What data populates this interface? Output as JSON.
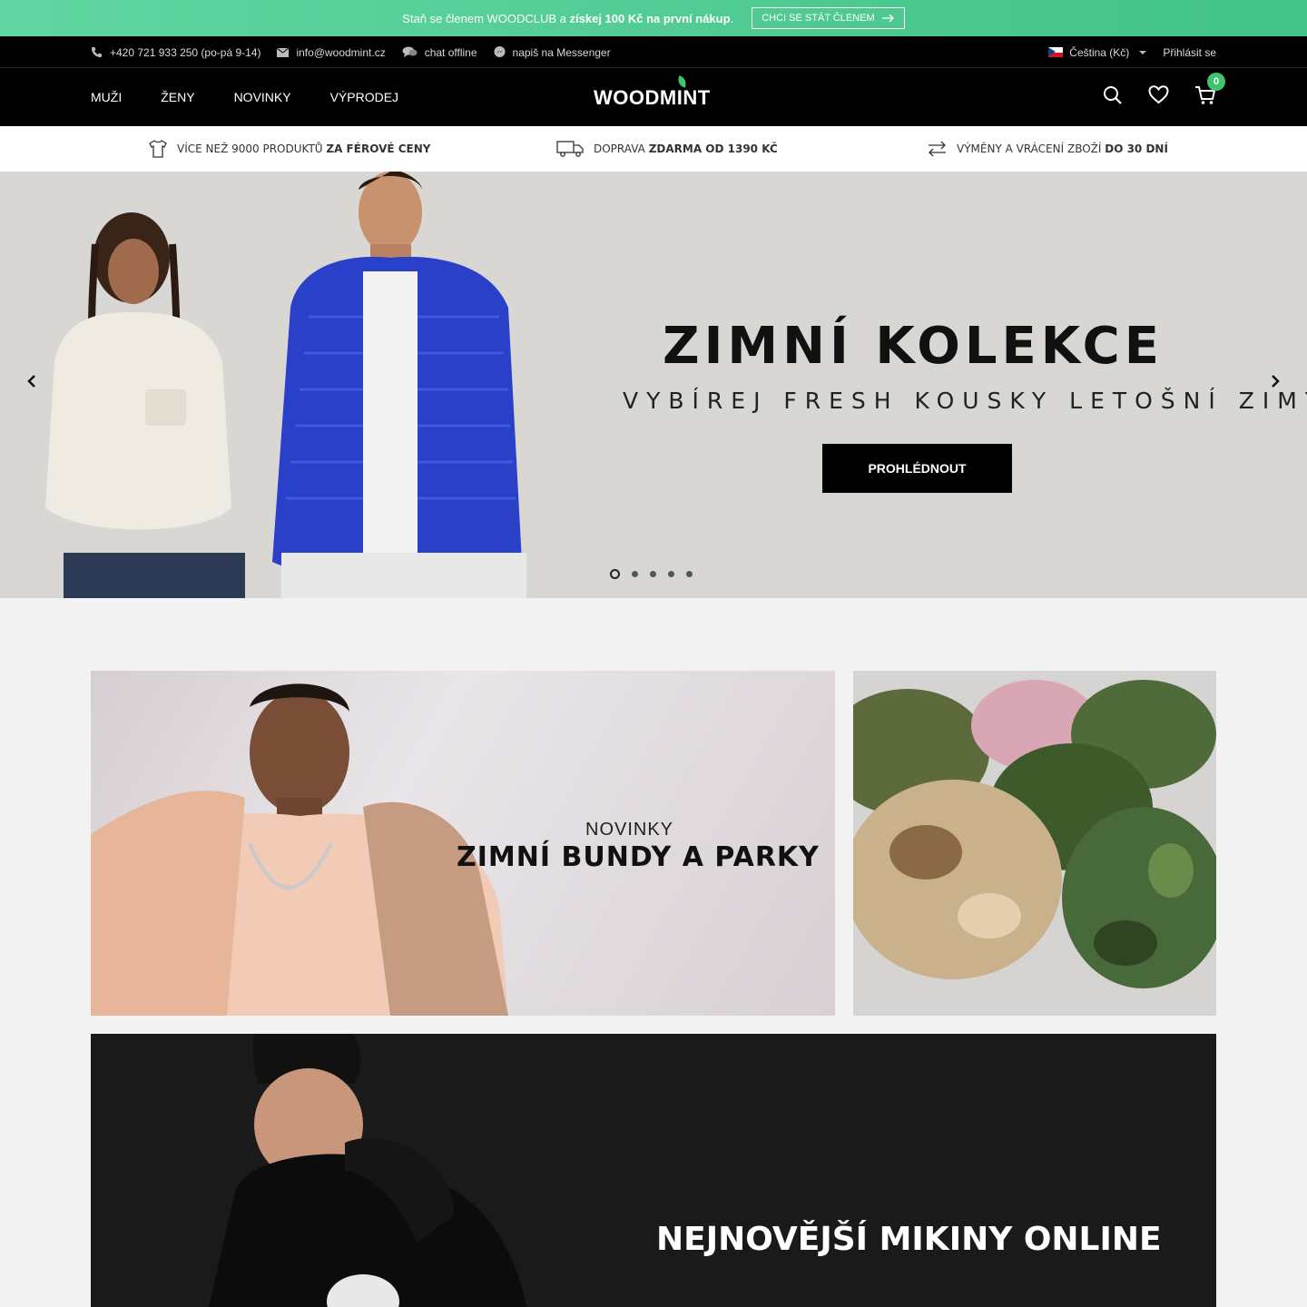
{
  "promo": {
    "text_start": "Staň se členem WOODCLUB a ",
    "text_bold": "získej 100 Kč na první nákup",
    "text_end": ".",
    "cta": "CHCI SE STÁT ČLENEM"
  },
  "topbar": {
    "phone": "+420 721 933 250 (po-pá 9-14)",
    "email": "info@woodmint.cz",
    "chat": "chat offline",
    "messenger": "napiš na Messenger",
    "language": "Čeština (Kč)",
    "login": "Přihlásit se"
  },
  "nav": {
    "items": [
      "MUŽI",
      "ŽENY",
      "NOVINKY",
      "VÝPRODEJ"
    ],
    "logo": "WOODMINT",
    "cart_count": "0"
  },
  "usp": [
    {
      "icon": "tshirt-icon",
      "text": "VÍCE NEŽ 9000 PRODUKTŮ ",
      "bold": "ZA FÉROVÉ CENY"
    },
    {
      "icon": "truck-icon",
      "text": "DOPRAVA ",
      "bold": "ZDARMA OD 1390 KČ"
    },
    {
      "icon": "exchange-icon",
      "text": "VÝMĚNY A VRÁCENÍ ZBOŽÍ ",
      "bold": "DO 30 DNÍ"
    }
  ],
  "hero": {
    "title": "ZIMNÍ KOLEKCE",
    "subtitle": "VYBÍREJ FRESH KOUSKY LETOŠNÍ ZIMY",
    "button": "PROHLÉDNOUT",
    "slide_count": 5,
    "active_slide": 1
  },
  "tiles": {
    "jackets": {
      "kicker": "NOVINKY",
      "title": "ZIMNÍ BUNDY A PARKY"
    },
    "hoodies": {
      "title": "NEJNOVĚJŠÍ MIKINY ONLINE"
    }
  },
  "colors": {
    "accent": "#3ec36f",
    "promo_gradient": [
      "#61d6a2",
      "#43c387"
    ],
    "nav_bg": "#000000"
  }
}
